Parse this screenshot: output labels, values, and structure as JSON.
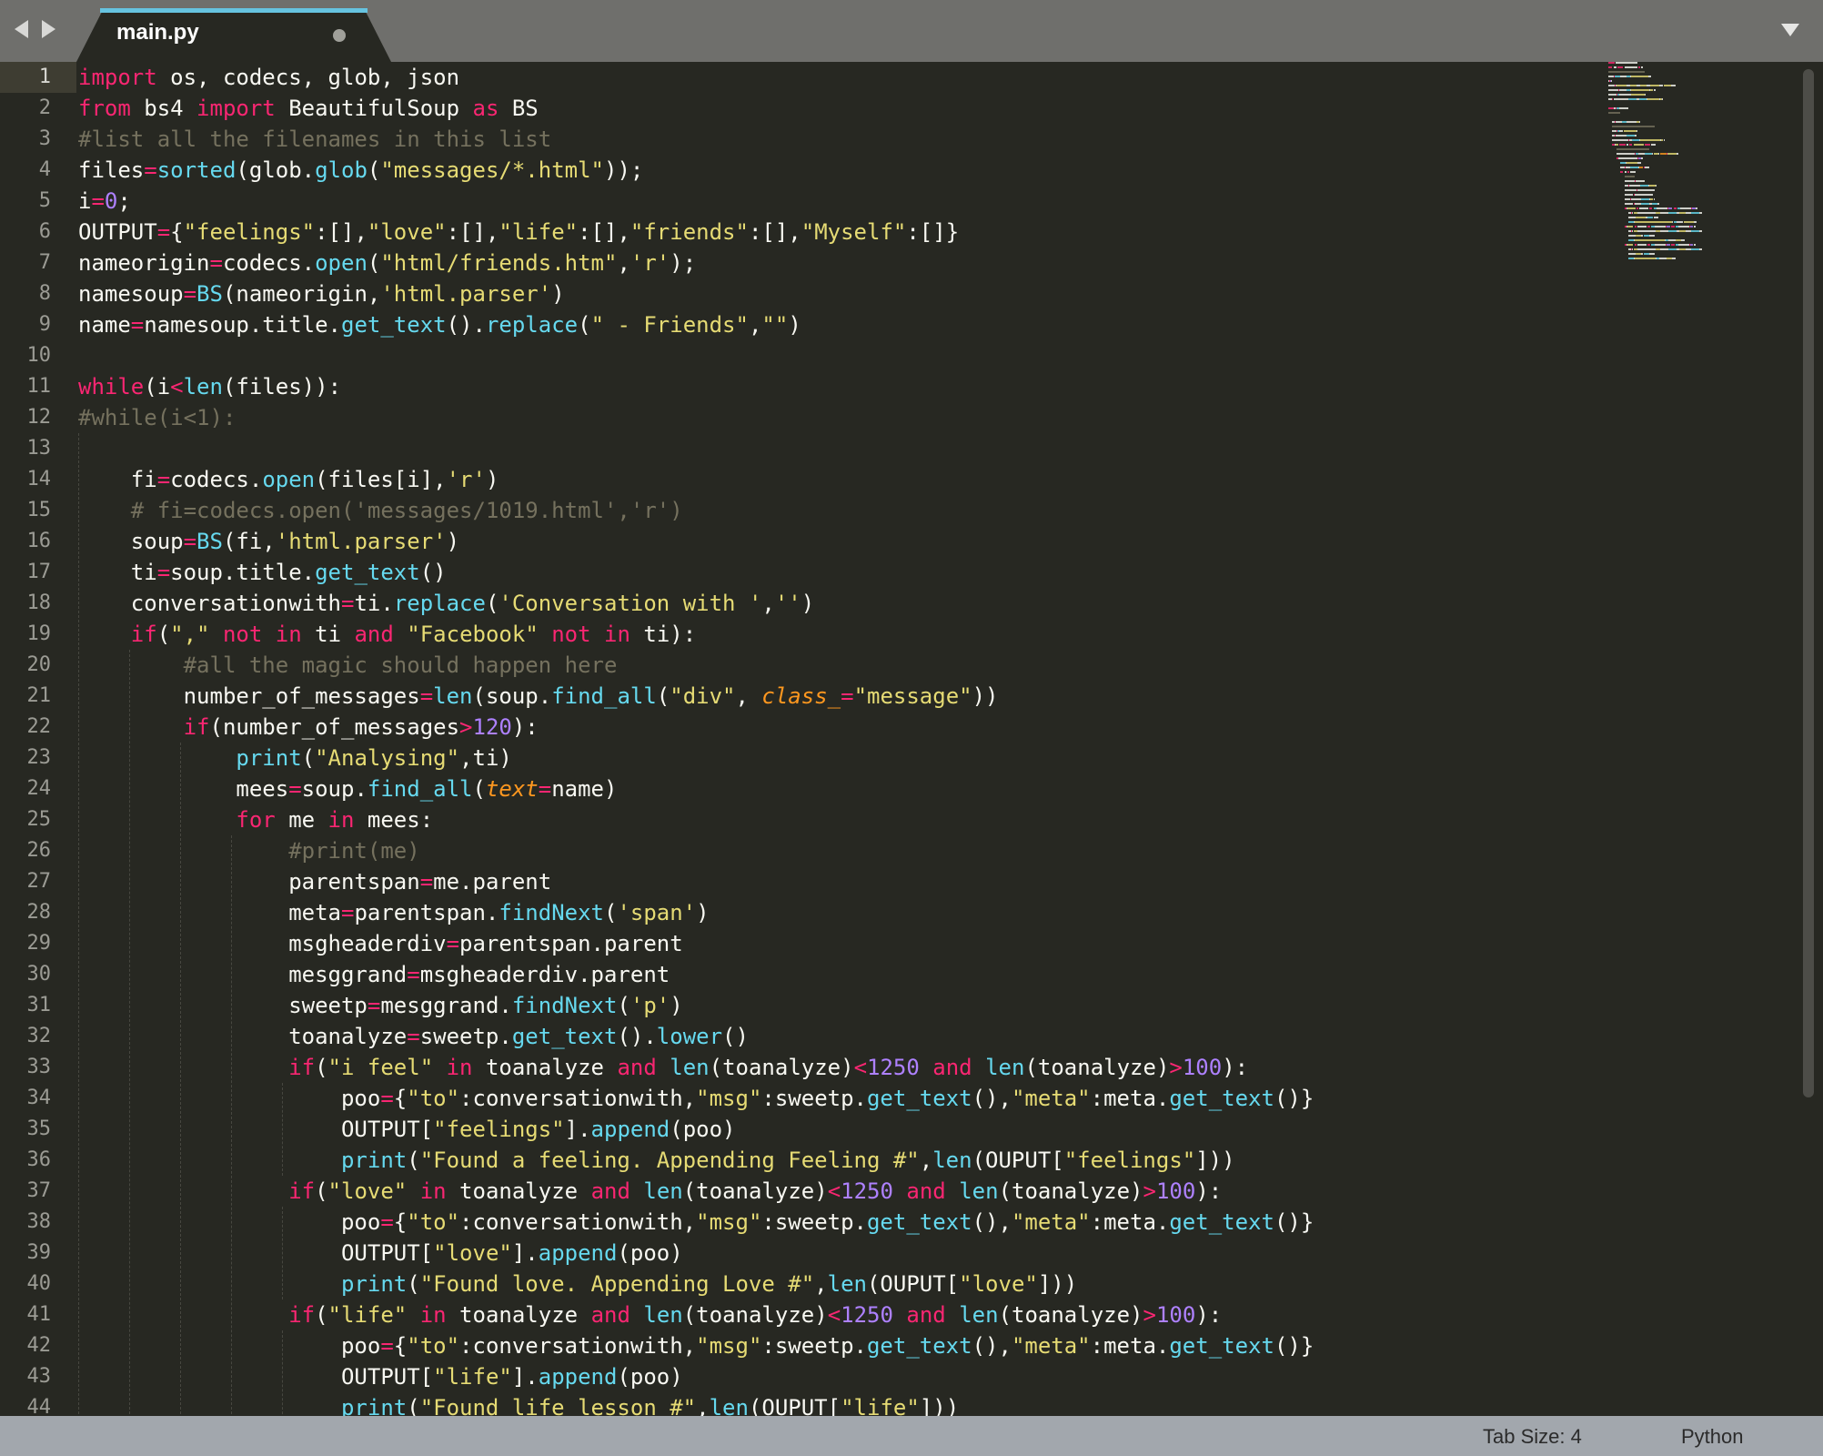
{
  "tabbar": {
    "active_tab": "main.py"
  },
  "gutter": {
    "line_numbers": [
      "1",
      "2",
      "3",
      "4",
      "5",
      "6",
      "7",
      "8",
      "9",
      "10",
      "11",
      "12",
      "13",
      "14",
      "15",
      "16",
      "17",
      "18",
      "19",
      "20",
      "21",
      "22",
      "23",
      "24",
      "25",
      "26",
      "27",
      "28",
      "29",
      "30",
      "31",
      "32",
      "33",
      "34",
      "35",
      "36",
      "37",
      "38",
      "39",
      "40",
      "41",
      "42",
      "43",
      "44"
    ]
  },
  "code": {
    "lines": [
      [
        [
          "kw",
          "import"
        ],
        [
          "p",
          " os, codecs, glob, json"
        ]
      ],
      [
        [
          "kw",
          "from"
        ],
        [
          "p",
          " bs4 "
        ],
        [
          "kw",
          "import"
        ],
        [
          "p",
          " BeautifulSoup "
        ],
        [
          "kw",
          "as"
        ],
        [
          "p",
          " BS"
        ]
      ],
      [
        [
          "com",
          "#list all the filenames in this list"
        ]
      ],
      [
        [
          "p",
          "files"
        ],
        [
          "op",
          "="
        ],
        [
          "fn",
          "sorted"
        ],
        [
          "p",
          "(glob."
        ],
        [
          "fn",
          "glob"
        ],
        [
          "p",
          "("
        ],
        [
          "str",
          "\"messages/*.html\""
        ],
        [
          "p",
          "));"
        ]
      ],
      [
        [
          "p",
          "i"
        ],
        [
          "op",
          "="
        ],
        [
          "num",
          "0"
        ],
        [
          "p",
          ";"
        ]
      ],
      [
        [
          "p",
          "OUTPUT"
        ],
        [
          "op",
          "="
        ],
        [
          "p",
          "{"
        ],
        [
          "str",
          "\"feelings\""
        ],
        [
          "p",
          ":[],"
        ],
        [
          "str",
          "\"love\""
        ],
        [
          "p",
          ":[],"
        ],
        [
          "str",
          "\"life\""
        ],
        [
          "p",
          ":[],"
        ],
        [
          "str",
          "\"friends\""
        ],
        [
          "p",
          ":[],"
        ],
        [
          "str",
          "\"Myself\""
        ],
        [
          "p",
          ":[]}"
        ]
      ],
      [
        [
          "p",
          "nameorigin"
        ],
        [
          "op",
          "="
        ],
        [
          "p",
          "codecs."
        ],
        [
          "fn",
          "open"
        ],
        [
          "p",
          "("
        ],
        [
          "str",
          "\"html/friends.htm\""
        ],
        [
          "p",
          ","
        ],
        [
          "str",
          "'r'"
        ],
        [
          "p",
          ");"
        ]
      ],
      [
        [
          "p",
          "namesoup"
        ],
        [
          "op",
          "="
        ],
        [
          "fn",
          "BS"
        ],
        [
          "p",
          "(nameorigin,"
        ],
        [
          "str",
          "'html.parser'"
        ],
        [
          "p",
          ")"
        ]
      ],
      [
        [
          "p",
          "name"
        ],
        [
          "op",
          "="
        ],
        [
          "p",
          "namesoup.title."
        ],
        [
          "fn",
          "get_text"
        ],
        [
          "p",
          "()."
        ],
        [
          "fn",
          "replace"
        ],
        [
          "p",
          "("
        ],
        [
          "str",
          "\" - Friends\""
        ],
        [
          "p",
          ","
        ],
        [
          "str",
          "\"\""
        ],
        [
          "p",
          ")"
        ]
      ],
      [],
      [
        [
          "kw",
          "while"
        ],
        [
          "p",
          "(i"
        ],
        [
          "op",
          "<"
        ],
        [
          "fn",
          "len"
        ],
        [
          "p",
          "(files)):"
        ]
      ],
      [
        [
          "com",
          "#while(i<1):"
        ]
      ],
      [],
      [
        [
          "p",
          "    fi"
        ],
        [
          "op",
          "="
        ],
        [
          "p",
          "codecs."
        ],
        [
          "fn",
          "open"
        ],
        [
          "p",
          "(files[i],"
        ],
        [
          "str",
          "'r'"
        ],
        [
          "p",
          ")"
        ]
      ],
      [
        [
          "p",
          "    "
        ],
        [
          "com",
          "# fi=codecs.open('messages/1019.html','r')"
        ]
      ],
      [
        [
          "p",
          "    soup"
        ],
        [
          "op",
          "="
        ],
        [
          "fn",
          "BS"
        ],
        [
          "p",
          "(fi,"
        ],
        [
          "str",
          "'html.parser'"
        ],
        [
          "p",
          ")"
        ]
      ],
      [
        [
          "p",
          "    ti"
        ],
        [
          "op",
          "="
        ],
        [
          "p",
          "soup.title."
        ],
        [
          "fn",
          "get_text"
        ],
        [
          "p",
          "()"
        ]
      ],
      [
        [
          "p",
          "    conversationwith"
        ],
        [
          "op",
          "="
        ],
        [
          "p",
          "ti."
        ],
        [
          "fn",
          "replace"
        ],
        [
          "p",
          "("
        ],
        [
          "str",
          "'Conversation with '"
        ],
        [
          "p",
          ","
        ],
        [
          "str",
          "''"
        ],
        [
          "p",
          ")"
        ]
      ],
      [
        [
          "p",
          "    "
        ],
        [
          "kw",
          "if"
        ],
        [
          "p",
          "("
        ],
        [
          "str",
          "\",\""
        ],
        [
          "p",
          " "
        ],
        [
          "kw",
          "not in"
        ],
        [
          "p",
          " ti "
        ],
        [
          "kw",
          "and"
        ],
        [
          "p",
          " "
        ],
        [
          "str",
          "\"Facebook\""
        ],
        [
          "p",
          " "
        ],
        [
          "kw",
          "not in"
        ],
        [
          "p",
          " ti):"
        ]
      ],
      [
        [
          "p",
          "        "
        ],
        [
          "com",
          "#all the magic should happen here"
        ]
      ],
      [
        [
          "p",
          "        number_of_messages"
        ],
        [
          "op",
          "="
        ],
        [
          "fn",
          "len"
        ],
        [
          "p",
          "(soup."
        ],
        [
          "fn",
          "find_all"
        ],
        [
          "p",
          "("
        ],
        [
          "str",
          "\"div\""
        ],
        [
          "p",
          ", "
        ],
        [
          "arg",
          "class_"
        ],
        [
          "op",
          "="
        ],
        [
          "str",
          "\"message\""
        ],
        [
          "p",
          "))"
        ]
      ],
      [
        [
          "p",
          "        "
        ],
        [
          "kw",
          "if"
        ],
        [
          "p",
          "(number_of_messages"
        ],
        [
          "op",
          ">"
        ],
        [
          "num",
          "120"
        ],
        [
          "p",
          "):"
        ]
      ],
      [
        [
          "p",
          "            "
        ],
        [
          "fn",
          "print"
        ],
        [
          "p",
          "("
        ],
        [
          "str",
          "\"Analysing\""
        ],
        [
          "p",
          ",ti)"
        ]
      ],
      [
        [
          "p",
          "            mees"
        ],
        [
          "op",
          "="
        ],
        [
          "p",
          "soup."
        ],
        [
          "fn",
          "find_all"
        ],
        [
          "p",
          "("
        ],
        [
          "arg",
          "text"
        ],
        [
          "op",
          "="
        ],
        [
          "p",
          "name)"
        ]
      ],
      [
        [
          "p",
          "            "
        ],
        [
          "kw",
          "for"
        ],
        [
          "p",
          " me "
        ],
        [
          "kw",
          "in"
        ],
        [
          "p",
          " mees:"
        ]
      ],
      [
        [
          "p",
          "                "
        ],
        [
          "com",
          "#print(me)"
        ]
      ],
      [
        [
          "p",
          "                parentspan"
        ],
        [
          "op",
          "="
        ],
        [
          "p",
          "me.parent"
        ]
      ],
      [
        [
          "p",
          "                meta"
        ],
        [
          "op",
          "="
        ],
        [
          "p",
          "parentspan."
        ],
        [
          "fn",
          "findNext"
        ],
        [
          "p",
          "("
        ],
        [
          "str",
          "'span'"
        ],
        [
          "p",
          ")"
        ]
      ],
      [
        [
          "p",
          "                msgheaderdiv"
        ],
        [
          "op",
          "="
        ],
        [
          "p",
          "parentspan.parent"
        ]
      ],
      [
        [
          "p",
          "                mesggrand"
        ],
        [
          "op",
          "="
        ],
        [
          "p",
          "msgheaderdiv.parent"
        ]
      ],
      [
        [
          "p",
          "                sweetp"
        ],
        [
          "op",
          "="
        ],
        [
          "p",
          "mesggrand."
        ],
        [
          "fn",
          "findNext"
        ],
        [
          "p",
          "("
        ],
        [
          "str",
          "'p'"
        ],
        [
          "p",
          ")"
        ]
      ],
      [
        [
          "p",
          "                toanalyze"
        ],
        [
          "op",
          "="
        ],
        [
          "p",
          "sweetp."
        ],
        [
          "fn",
          "get_text"
        ],
        [
          "p",
          "()."
        ],
        [
          "fn",
          "lower"
        ],
        [
          "p",
          "()"
        ]
      ],
      [
        [
          "p",
          "                "
        ],
        [
          "kw",
          "if"
        ],
        [
          "p",
          "("
        ],
        [
          "str",
          "\"i feel\""
        ],
        [
          "p",
          " "
        ],
        [
          "kw",
          "in"
        ],
        [
          "p",
          " toanalyze "
        ],
        [
          "kw",
          "and"
        ],
        [
          "p",
          " "
        ],
        [
          "fn",
          "len"
        ],
        [
          "p",
          "(toanalyze)"
        ],
        [
          "op",
          "<"
        ],
        [
          "num",
          "1250"
        ],
        [
          "p",
          " "
        ],
        [
          "kw",
          "and"
        ],
        [
          "p",
          " "
        ],
        [
          "fn",
          "len"
        ],
        [
          "p",
          "(toanalyze)"
        ],
        [
          "op",
          ">"
        ],
        [
          "num",
          "100"
        ],
        [
          "p",
          "):"
        ]
      ],
      [
        [
          "p",
          "                    poo"
        ],
        [
          "op",
          "="
        ],
        [
          "p",
          "{"
        ],
        [
          "str",
          "\"to\""
        ],
        [
          "p",
          ":conversationwith,"
        ],
        [
          "str",
          "\"msg\""
        ],
        [
          "p",
          ":sweetp."
        ],
        [
          "fn",
          "get_text"
        ],
        [
          "p",
          "(),"
        ],
        [
          "str",
          "\"meta\""
        ],
        [
          "p",
          ":meta."
        ],
        [
          "fn",
          "get_text"
        ],
        [
          "p",
          "()}"
        ]
      ],
      [
        [
          "p",
          "                    OUTPUT["
        ],
        [
          "str",
          "\"feelings\""
        ],
        [
          "p",
          "]."
        ],
        [
          "fn",
          "append"
        ],
        [
          "p",
          "(poo)"
        ]
      ],
      [
        [
          "p",
          "                    "
        ],
        [
          "fn",
          "print"
        ],
        [
          "p",
          "("
        ],
        [
          "str",
          "\"Found a feeling. Appending Feeling #\""
        ],
        [
          "p",
          ","
        ],
        [
          "fn",
          "len"
        ],
        [
          "p",
          "(OUPUT["
        ],
        [
          "str",
          "\"feelings\""
        ],
        [
          "p",
          "]))"
        ]
      ],
      [
        [
          "p",
          "                "
        ],
        [
          "kw",
          "if"
        ],
        [
          "p",
          "("
        ],
        [
          "str",
          "\"love\""
        ],
        [
          "p",
          " "
        ],
        [
          "kw",
          "in"
        ],
        [
          "p",
          " toanalyze "
        ],
        [
          "kw",
          "and"
        ],
        [
          "p",
          " "
        ],
        [
          "fn",
          "len"
        ],
        [
          "p",
          "(toanalyze)"
        ],
        [
          "op",
          "<"
        ],
        [
          "num",
          "1250"
        ],
        [
          "p",
          " "
        ],
        [
          "kw",
          "and"
        ],
        [
          "p",
          " "
        ],
        [
          "fn",
          "len"
        ],
        [
          "p",
          "(toanalyze)"
        ],
        [
          "op",
          ">"
        ],
        [
          "num",
          "100"
        ],
        [
          "p",
          "):"
        ]
      ],
      [
        [
          "p",
          "                    poo"
        ],
        [
          "op",
          "="
        ],
        [
          "p",
          "{"
        ],
        [
          "str",
          "\"to\""
        ],
        [
          "p",
          ":conversationwith,"
        ],
        [
          "str",
          "\"msg\""
        ],
        [
          "p",
          ":sweetp."
        ],
        [
          "fn",
          "get_text"
        ],
        [
          "p",
          "(),"
        ],
        [
          "str",
          "\"meta\""
        ],
        [
          "p",
          ":meta."
        ],
        [
          "fn",
          "get_text"
        ],
        [
          "p",
          "()}"
        ]
      ],
      [
        [
          "p",
          "                    OUTPUT["
        ],
        [
          "str",
          "\"love\""
        ],
        [
          "p",
          "]."
        ],
        [
          "fn",
          "append"
        ],
        [
          "p",
          "(poo)"
        ]
      ],
      [
        [
          "p",
          "                    "
        ],
        [
          "fn",
          "print"
        ],
        [
          "p",
          "("
        ],
        [
          "str",
          "\"Found love. Appending Love #\""
        ],
        [
          "p",
          ","
        ],
        [
          "fn",
          "len"
        ],
        [
          "p",
          "(OUPUT["
        ],
        [
          "str",
          "\"love\""
        ],
        [
          "p",
          "]))"
        ]
      ],
      [
        [
          "p",
          "                "
        ],
        [
          "kw",
          "if"
        ],
        [
          "p",
          "("
        ],
        [
          "str",
          "\"life\""
        ],
        [
          "p",
          " "
        ],
        [
          "kw",
          "in"
        ],
        [
          "p",
          " toanalyze "
        ],
        [
          "kw",
          "and"
        ],
        [
          "p",
          " "
        ],
        [
          "fn",
          "len"
        ],
        [
          "p",
          "(toanalyze)"
        ],
        [
          "op",
          "<"
        ],
        [
          "num",
          "1250"
        ],
        [
          "p",
          " "
        ],
        [
          "kw",
          "and"
        ],
        [
          "p",
          " "
        ],
        [
          "fn",
          "len"
        ],
        [
          "p",
          "(toanalyze)"
        ],
        [
          "op",
          ">"
        ],
        [
          "num",
          "100"
        ],
        [
          "p",
          "):"
        ]
      ],
      [
        [
          "p",
          "                    poo"
        ],
        [
          "op",
          "="
        ],
        [
          "p",
          "{"
        ],
        [
          "str",
          "\"to\""
        ],
        [
          "p",
          ":conversationwith,"
        ],
        [
          "str",
          "\"msg\""
        ],
        [
          "p",
          ":sweetp."
        ],
        [
          "fn",
          "get_text"
        ],
        [
          "p",
          "(),"
        ],
        [
          "str",
          "\"meta\""
        ],
        [
          "p",
          ":meta."
        ],
        [
          "fn",
          "get_text"
        ],
        [
          "p",
          "()}"
        ]
      ],
      [
        [
          "p",
          "                    OUTPUT["
        ],
        [
          "str",
          "\"life\""
        ],
        [
          "p",
          "]."
        ],
        [
          "fn",
          "append"
        ],
        [
          "p",
          "(poo)"
        ]
      ],
      [
        [
          "p",
          "                    "
        ],
        [
          "fn",
          "print"
        ],
        [
          "p",
          "("
        ],
        [
          "str",
          "\"Found life lesson #\""
        ],
        [
          "p",
          ","
        ],
        [
          "fn",
          "len"
        ],
        [
          "p",
          "(OUPUT["
        ],
        [
          "str",
          "\"life\""
        ],
        [
          "p",
          "]))"
        ]
      ]
    ]
  },
  "statusbar": {
    "tab_size": "Tab Size: 4",
    "syntax": "Python"
  },
  "icons": {
    "nav_back": "chevron-left-icon",
    "nav_forward": "chevron-right-icon",
    "tab_modified": "dot-icon",
    "tabs_menu": "chevron-down-icon"
  },
  "theme": {
    "background": "#272822",
    "keyword": "#f92672",
    "string": "#e6db74",
    "comment": "#75715e",
    "function": "#66d9ef",
    "number": "#ae81ff",
    "argument": "#fd971f",
    "tab_accent": "#66c3e0",
    "status_bar": "#a2a7ad"
  }
}
